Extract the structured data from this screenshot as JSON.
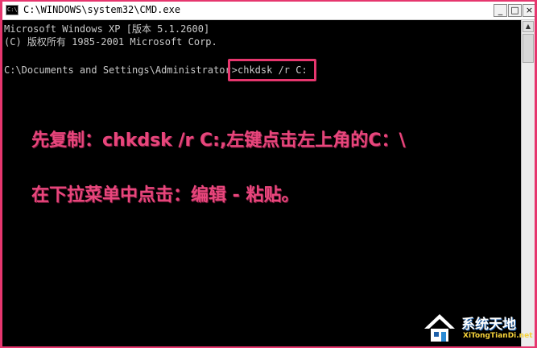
{
  "window": {
    "icon_text": "C:\\",
    "title": "C:\\WINDOWS\\system32\\CMD.exe",
    "min_label": "_",
    "max_label": "□",
    "close_label": "×"
  },
  "console": {
    "line1": "Microsoft Windows XP [版本 5.1.2600]",
    "line2": "(C) 版权所有 1985-2001 Microsoft Corp.",
    "prompt": "C:\\Documents and Settings\\Administrator",
    "command": ">chkdsk /r C:"
  },
  "scrollbar": {
    "up_arrow": "▲"
  },
  "annotations": {
    "line1": "先复制：chkdsk /r C:,左键点击左上角的C：\\",
    "line2": "在下拉菜单中点击：编辑 - 粘贴。"
  },
  "watermark": {
    "name": "系统天地",
    "url": "XiTongTianDi.net"
  }
}
